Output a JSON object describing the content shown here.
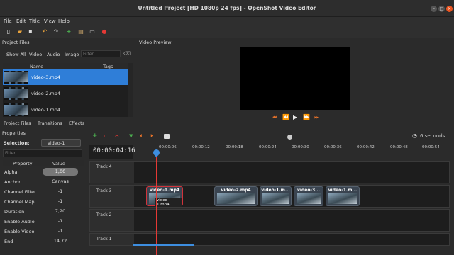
{
  "window": {
    "title": "Untitled Project [HD 1080p 24 fps] - OpenShot Video Editor"
  },
  "menu": [
    "File",
    "Edit",
    "Title",
    "View",
    "Help"
  ],
  "project_files": {
    "title": "Project Files",
    "tabs": [
      "Show All",
      "Video",
      "Audio",
      "Image"
    ],
    "filter_placeholder": "Filter",
    "col_name": "Name",
    "col_tags": "Tags",
    "files": [
      "video-3.mp4",
      "video-2.mp4",
      "video-1.mp4"
    ]
  },
  "bottom_tabs": [
    "Project Files",
    "Transitions",
    "Effects"
  ],
  "properties": {
    "title": "Properties",
    "selection_label": "Selection:",
    "selection_value": "video-1",
    "filter_placeholder": "Filter",
    "col_property": "Property",
    "col_value": "Value",
    "rows": [
      {
        "k": "Alpha",
        "v": "1,00"
      },
      {
        "k": "Anchor",
        "v": "Canvas"
      },
      {
        "k": "Channel Filter",
        "v": "-1"
      },
      {
        "k": "Channel Map...",
        "v": "-1"
      },
      {
        "k": "Duration",
        "v": "7,20"
      },
      {
        "k": "Enable Audio",
        "v": "-1"
      },
      {
        "k": "Enable Video",
        "v": "-1"
      },
      {
        "k": "End",
        "v": "14,72"
      }
    ]
  },
  "video_preview": {
    "title": "Video Preview"
  },
  "timeline": {
    "zoom_label": "6 seconds",
    "timecode": "00:00:04:16",
    "ruler": [
      "00:00:06",
      "00:00:12",
      "00:00:18",
      "00:00:24",
      "00:00:30",
      "00:00:36",
      "00:00:42",
      "00:00:48",
      "00:00:54"
    ],
    "tracks": [
      "Track 4",
      "Track 3",
      "Track 2",
      "Track 1"
    ],
    "clips": [
      {
        "label": "video-1.mp4",
        "sub": "video-1.mp4"
      },
      {
        "label": "video-2.mp4"
      },
      {
        "label": "video-1.m..."
      },
      {
        "label": "video-3..."
      },
      {
        "label": "video-1.m..."
      }
    ]
  }
}
